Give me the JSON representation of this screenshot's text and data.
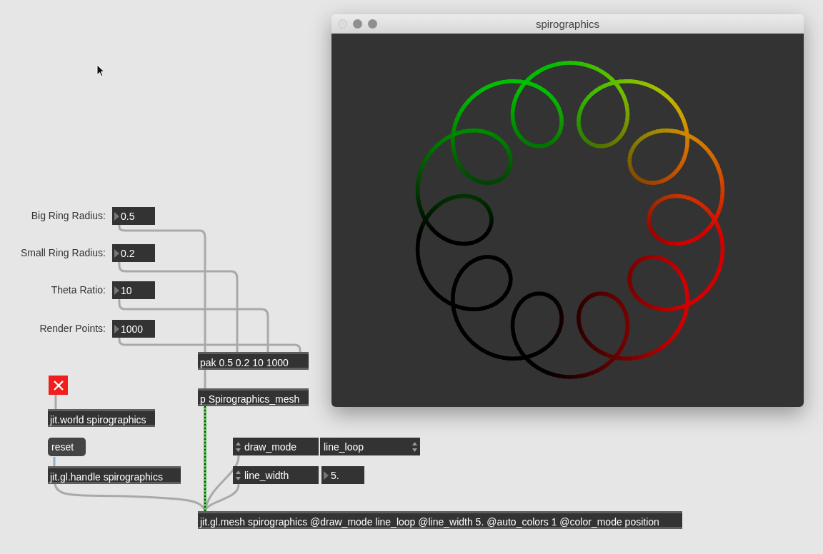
{
  "patcher": {
    "number_boxes": [
      {
        "label": "Big Ring Radius:",
        "value": "0.5"
      },
      {
        "label": "Small Ring Radius:",
        "value": "0.2"
      },
      {
        "label": "Theta Ratio:",
        "value": "10"
      },
      {
        "label": "Render Points:",
        "value": "1000"
      }
    ],
    "objects": [
      "pak 0.5 0.2 10 1000",
      "p Spirographics_mesh",
      "jit.world spirographics",
      "jit.gl.handle spirographics",
      "jit.gl.mesh spirographics @draw_mode line_loop @line_width 5. @auto_colors 1 @color_mode position"
    ],
    "toggle": {
      "checked": true
    },
    "message": "reset",
    "attrui": [
      {
        "kind": "menu",
        "name": "draw_mode",
        "value": "line_loop"
      },
      {
        "kind": "number",
        "name": "line_width",
        "value": "5."
      }
    ]
  },
  "render_window": {
    "title": "spirographics"
  }
}
